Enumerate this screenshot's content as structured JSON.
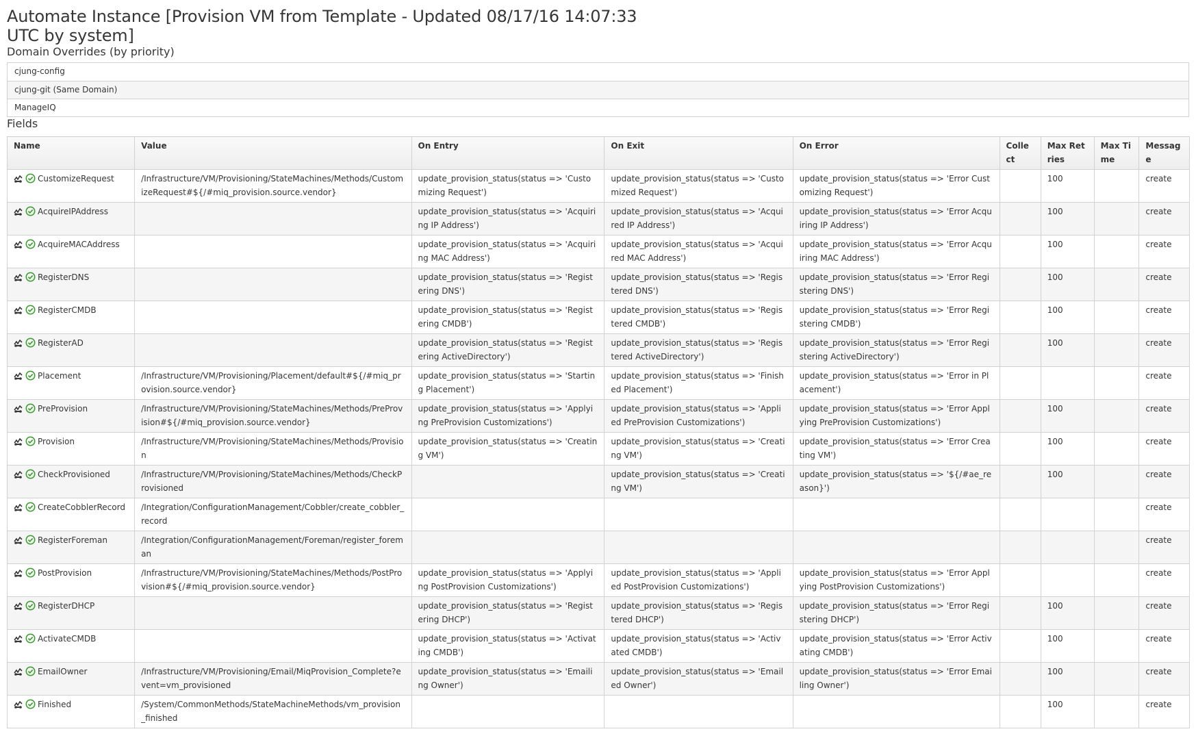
{
  "page": {
    "title": "Automate Instance [Provision VM from Template - Updated 08/17/16 14:07:33 UTC by system]"
  },
  "domain_overrides": {
    "title": "Domain Overrides (by priority)",
    "items": [
      "cjung-config",
      "cjung-git (Same Domain)",
      "ManageIQ"
    ]
  },
  "fields": {
    "title": "Fields",
    "headers": [
      "Name",
      "Value",
      "On Entry",
      "On Exit",
      "On Error",
      "Collect",
      "Max Retries",
      "Max Time",
      "Message"
    ],
    "rows": [
      {
        "name": "CustomizeRequest",
        "value": "/Infrastructure/VM/Provisioning/StateMachines/Methods/CustomizeRequest#${/#miq_provision.source.vendor}",
        "on_entry": "update_provision_status(status => 'Customizing Request')",
        "on_exit": "update_provision_status(status => 'Customized Request')",
        "on_error": "update_provision_status(status => 'Error Customizing Request')",
        "collect": "",
        "max_retries": "100",
        "max_time": "",
        "message": "create"
      },
      {
        "name": "AcquireIPAddress",
        "value": "",
        "on_entry": "update_provision_status(status => 'Acquiring IP Address')",
        "on_exit": "update_provision_status(status => 'Acquired IP Address')",
        "on_error": "update_provision_status(status => 'Error Acquiring IP Address')",
        "collect": "",
        "max_retries": "100",
        "max_time": "",
        "message": "create"
      },
      {
        "name": "AcquireMACAddress",
        "value": "",
        "on_entry": "update_provision_status(status => 'Acquiring MAC Address')",
        "on_exit": "update_provision_status(status => 'Acquired MAC Address')",
        "on_error": "update_provision_status(status => 'Error Acquiring MAC Address')",
        "collect": "",
        "max_retries": "100",
        "max_time": "",
        "message": "create"
      },
      {
        "name": "RegisterDNS",
        "value": "",
        "on_entry": "update_provision_status(status => 'Registering DNS')",
        "on_exit": "update_provision_status(status => 'Registered DNS')",
        "on_error": "update_provision_status(status => 'Error Registering DNS')",
        "collect": "",
        "max_retries": "100",
        "max_time": "",
        "message": "create"
      },
      {
        "name": "RegisterCMDB",
        "value": "",
        "on_entry": "update_provision_status(status => 'Registering CMDB')",
        "on_exit": "update_provision_status(status => 'Registered CMDB')",
        "on_error": "update_provision_status(status => 'Error Registering CMDB')",
        "collect": "",
        "max_retries": "100",
        "max_time": "",
        "message": "create"
      },
      {
        "name": "RegisterAD",
        "value": "",
        "on_entry": "update_provision_status(status => 'Registering ActiveDirectory')",
        "on_exit": "update_provision_status(status => 'Registered ActiveDirectory')",
        "on_error": "update_provision_status(status => 'Error Registering ActiveDirectory')",
        "collect": "",
        "max_retries": "100",
        "max_time": "",
        "message": "create"
      },
      {
        "name": "Placement",
        "value": "/Infrastructure/VM/Provisioning/Placement/default#${/#miq_provision.source.vendor}",
        "on_entry": "update_provision_status(status => 'Starting Placement')",
        "on_exit": "update_provision_status(status => 'Finished Placement')",
        "on_error": "update_provision_status(status => 'Error in Placement')",
        "collect": "",
        "max_retries": "",
        "max_time": "",
        "message": "create"
      },
      {
        "name": "PreProvision",
        "value": "/Infrastructure/VM/Provisioning/StateMachines/Methods/PreProvision#${/#miq_provision.source.vendor}",
        "on_entry": "update_provision_status(status => 'Applying PreProvision Customizations')",
        "on_exit": "update_provision_status(status => 'Applied PreProvision Customizations')",
        "on_error": "update_provision_status(status => 'Error Applying PreProvision Customizations')",
        "collect": "",
        "max_retries": "100",
        "max_time": "",
        "message": "create"
      },
      {
        "name": "Provision",
        "value": "/Infrastructure/VM/Provisioning/StateMachines/Methods/Provision",
        "on_entry": "update_provision_status(status => 'Creating VM')",
        "on_exit": "update_provision_status(status => 'Creating VM')",
        "on_error": "update_provision_status(status => 'Error Creating VM')",
        "collect": "",
        "max_retries": "100",
        "max_time": "",
        "message": "create"
      },
      {
        "name": "CheckProvisioned",
        "value": "/Infrastructure/VM/Provisioning/StateMachines/Methods/CheckProvisioned",
        "on_entry": "",
        "on_exit": "update_provision_status(status => 'Creating VM')",
        "on_error": "update_provision_status(status => '${/#ae_reason}')",
        "collect": "",
        "max_retries": "100",
        "max_time": "",
        "message": "create"
      },
      {
        "name": "CreateCobblerRecord",
        "value": "/Integration/ConfigurationManagement/Cobbler/create_cobbler_record",
        "on_entry": "",
        "on_exit": "",
        "on_error": "",
        "collect": "",
        "max_retries": "",
        "max_time": "",
        "message": "create"
      },
      {
        "name": "RegisterForeman",
        "value": "/Integration/ConfigurationManagement/Foreman/register_foreman",
        "on_entry": "",
        "on_exit": "",
        "on_error": "",
        "collect": "",
        "max_retries": "",
        "max_time": "",
        "message": "create"
      },
      {
        "name": "PostProvision",
        "value": "/Infrastructure/VM/Provisioning/StateMachines/Methods/PostProvision#${/#miq_provision.source.vendor}",
        "on_entry": "update_provision_status(status => 'Applying PostProvision Customizations')",
        "on_exit": "update_provision_status(status => 'Applied PostProvision Customizations')",
        "on_error": "update_provision_status(status => 'Error Applying PostProvision Customizations')",
        "collect": "",
        "max_retries": "",
        "max_time": "",
        "message": "create"
      },
      {
        "name": "RegisterDHCP",
        "value": "",
        "on_entry": "update_provision_status(status => 'Registering DHCP')",
        "on_exit": "update_provision_status(status => 'Registered DHCP')",
        "on_error": "update_provision_status(status => 'Error Registering DHCP')",
        "collect": "",
        "max_retries": "100",
        "max_time": "",
        "message": "create"
      },
      {
        "name": "ActivateCMDB",
        "value": "",
        "on_entry": "update_provision_status(status => 'Activating CMDB')",
        "on_exit": "update_provision_status(status => 'Activated CMDB')",
        "on_error": "update_provision_status(status => 'Error Activating CMDB')",
        "collect": "",
        "max_retries": "100",
        "max_time": "",
        "message": "create"
      },
      {
        "name": "EmailOwner",
        "value": "/Infrastructure/VM/Provisioning/Email/MiqProvision_Complete?event=vm_provisioned",
        "on_entry": "update_provision_status(status => 'Emailing Owner')",
        "on_exit": "update_provision_status(status => 'Emailed Owner')",
        "on_error": "update_provision_status(status => 'Error Emailing Owner')",
        "collect": "",
        "max_retries": "100",
        "max_time": "",
        "message": "create"
      },
      {
        "name": "Finished",
        "value": "/System/CommonMethods/StateMachineMethods/vm_provision_finished",
        "on_entry": "",
        "on_exit": "",
        "on_error": "",
        "collect": "",
        "max_retries": "100",
        "max_time": "",
        "message": "create"
      }
    ],
    "row_icons": [
      "state-machine-icon",
      "check-circle-icon"
    ]
  },
  "colors": {
    "check_green": "#3f9c35",
    "icon_dark": "#363636",
    "border": "#d1d1d1",
    "stripe": "#f5f5f5"
  }
}
